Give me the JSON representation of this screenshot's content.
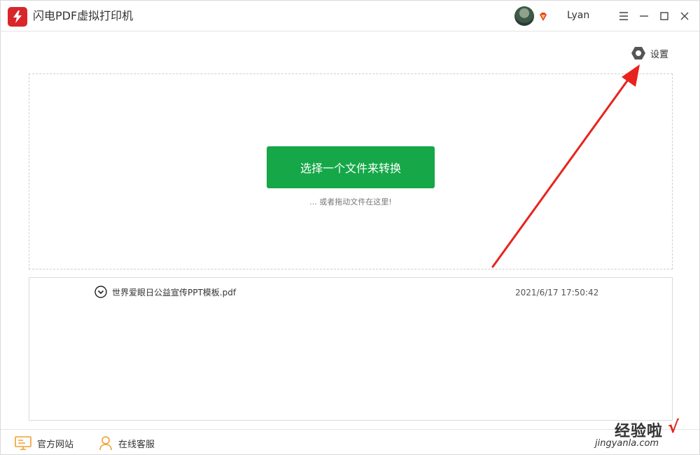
{
  "app": {
    "title": "闪电PDF虚拟打印机"
  },
  "user": {
    "name": "Lyan"
  },
  "titlebar": {
    "icons": [
      "menu-icon",
      "minimize-icon",
      "maximize-icon",
      "close-icon"
    ]
  },
  "settings": {
    "label": "设置"
  },
  "dropzone": {
    "button_label": "选择一个文件来转换",
    "hint": "... 或者拖动文件在这里!"
  },
  "files": [
    {
      "name": "世界爱眼日公益宣传PPT模板.pdf",
      "time": "2021/6/17 17:50:42"
    }
  ],
  "footer": {
    "website_label": "官方网站",
    "support_label": "在线客服"
  },
  "colors": {
    "accent_green": "#15a748",
    "brand_red": "#d8262b",
    "annotation_red": "#e8231c"
  },
  "watermark": {
    "title": "经验啦",
    "url": "jingyanla.com",
    "check": "√"
  }
}
